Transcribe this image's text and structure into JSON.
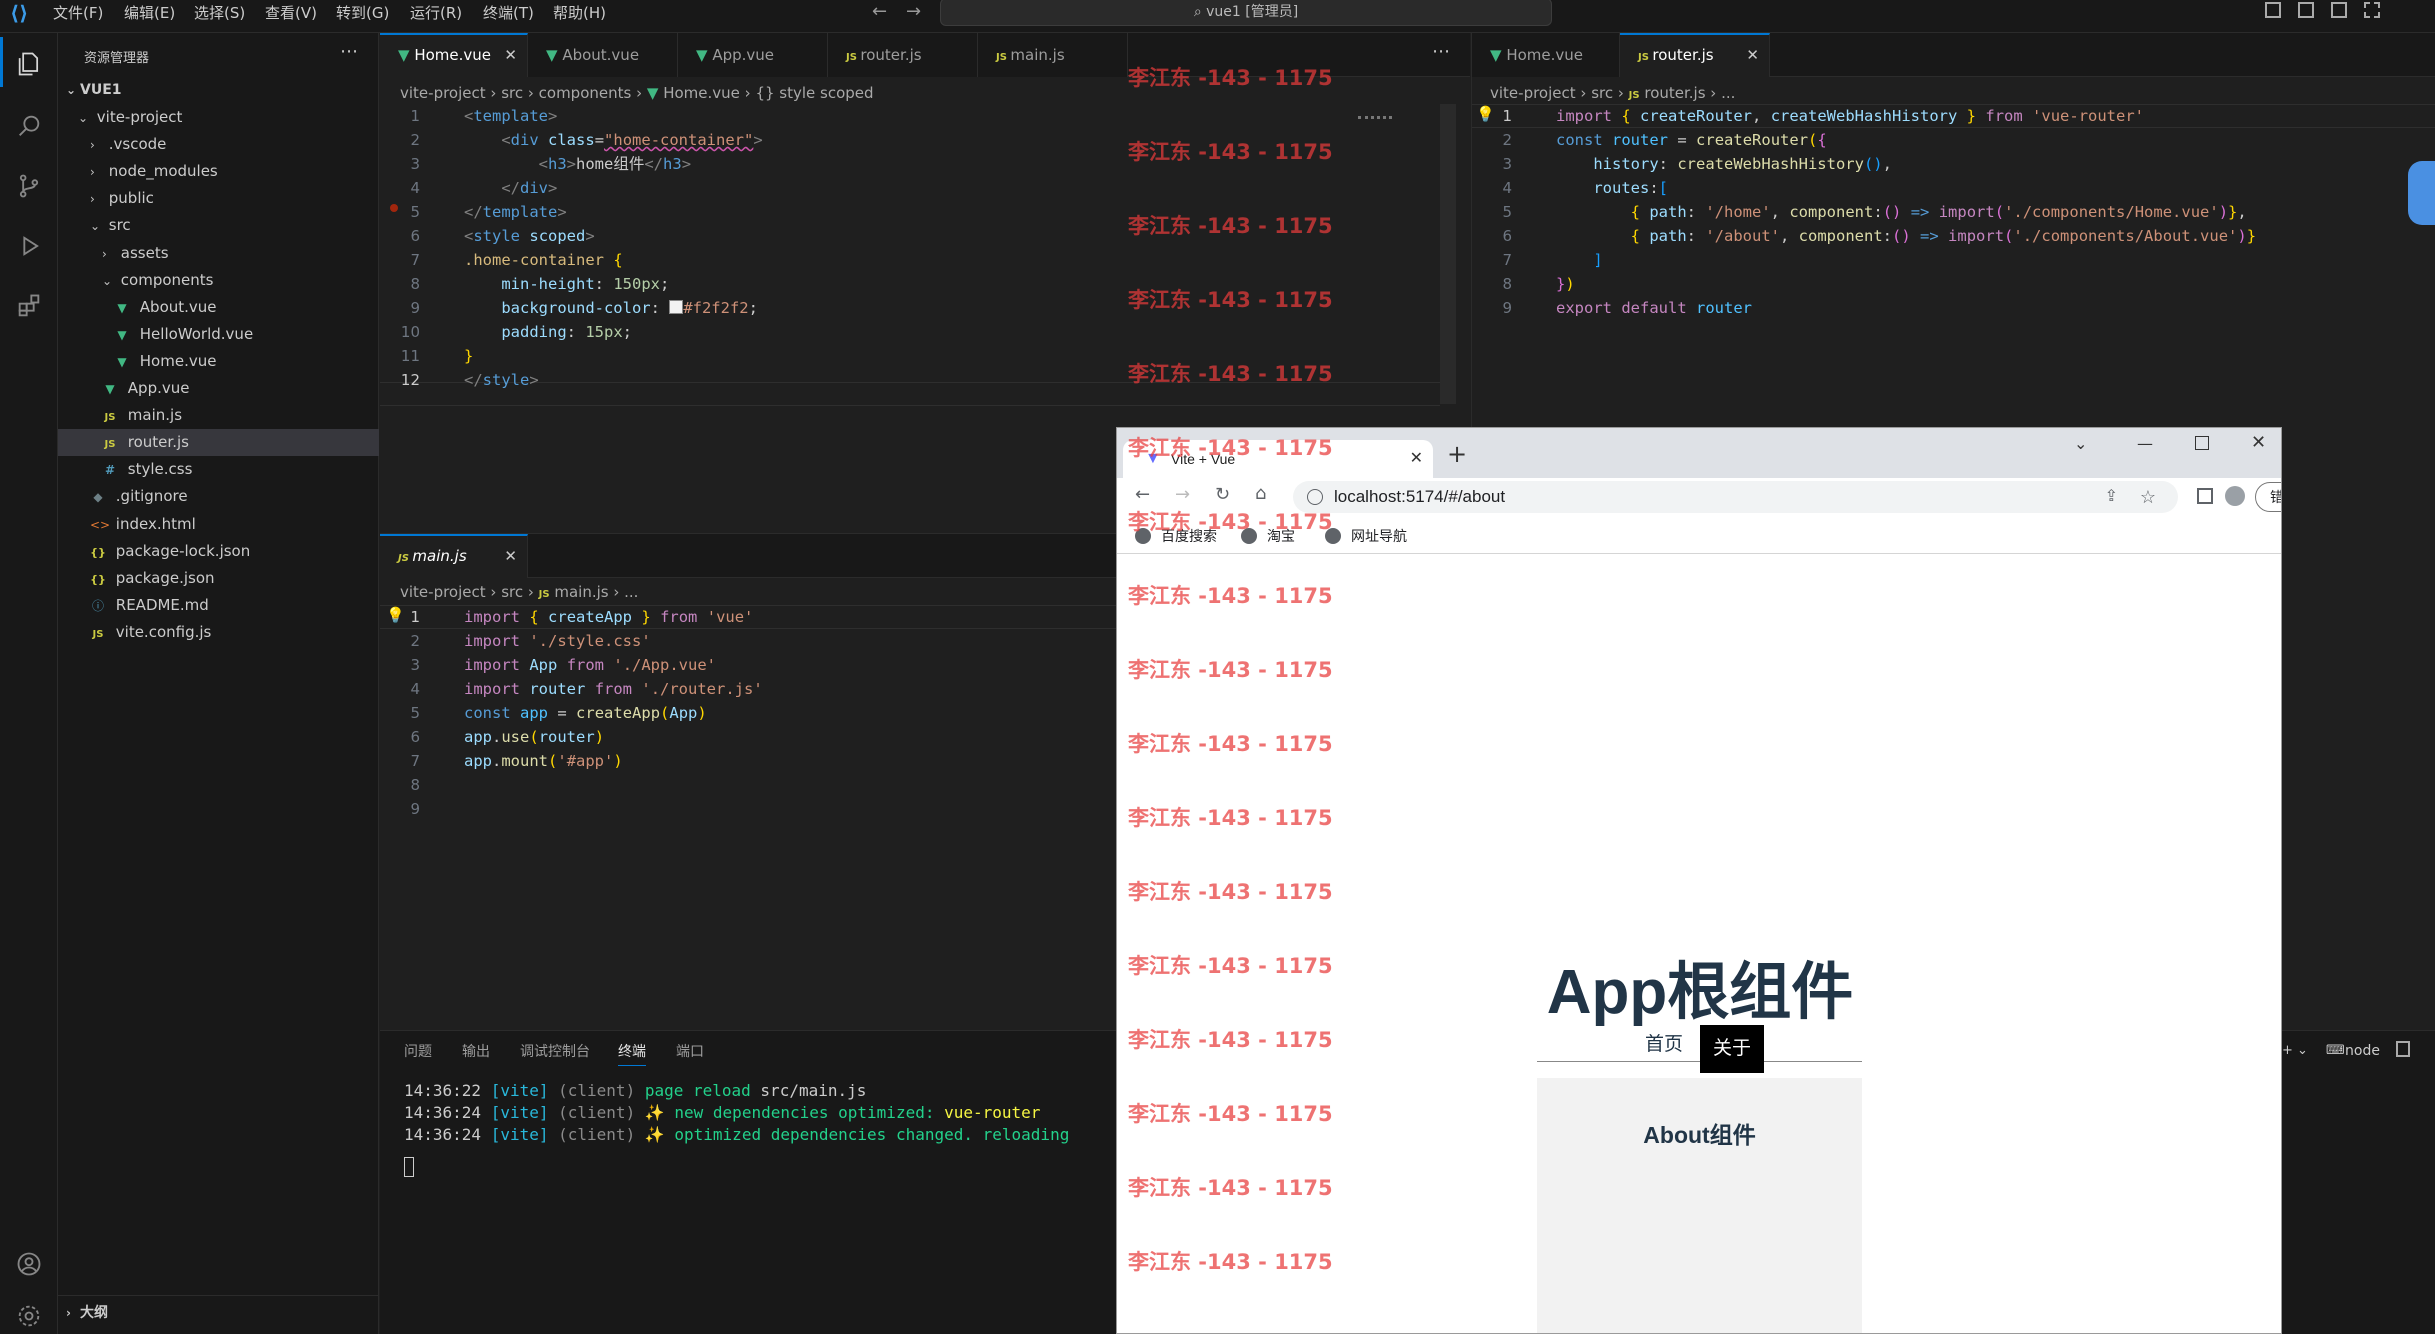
{
  "menu": [
    "文件(F)",
    "编辑(E)",
    "选择(S)",
    "查看(V)",
    "转到(G)",
    "运行(R)",
    "终端(T)",
    "帮助(H)"
  ],
  "window_title": "vue1 [管理员]",
  "explorer": {
    "title": "资源管理器",
    "root": "VUE1",
    "items": [
      {
        "label": "vite-project",
        "type": "folder-open"
      },
      {
        "label": ".vscode",
        "type": "folder"
      },
      {
        "label": "node_modules",
        "type": "folder"
      },
      {
        "label": "public",
        "type": "folder"
      },
      {
        "label": "src",
        "type": "folder-open"
      },
      {
        "label": "assets",
        "type": "folder"
      },
      {
        "label": "components",
        "type": "folder-open"
      },
      {
        "label": "About.vue",
        "type": "vue"
      },
      {
        "label": "HelloWorld.vue",
        "type": "vue"
      },
      {
        "label": "Home.vue",
        "type": "vue"
      },
      {
        "label": "App.vue",
        "type": "vue"
      },
      {
        "label": "main.js",
        "type": "js"
      },
      {
        "label": "router.js",
        "type": "js"
      },
      {
        "label": "style.css",
        "type": "css"
      },
      {
        "label": ".gitignore",
        "type": "git"
      },
      {
        "label": "index.html",
        "type": "html"
      },
      {
        "label": "package-lock.json",
        "type": "json"
      },
      {
        "label": "package.json",
        "type": "json"
      },
      {
        "label": "README.md",
        "type": "info"
      },
      {
        "label": "vite.config.js",
        "type": "js"
      }
    ],
    "outline": "大纲"
  },
  "editor1": {
    "tabs": [
      "Home.vue",
      "About.vue",
      "App.vue",
      "router.js",
      "main.js"
    ],
    "breadcrumb": [
      "vite-project",
      "src",
      "components",
      "Home.vue",
      "{} style scoped"
    ],
    "line_numbers": [
      "1",
      "2",
      "3",
      "4",
      "5",
      "6",
      "7",
      "8",
      "9",
      "10",
      "11",
      "12"
    ]
  },
  "editor2": {
    "tab": "main.js",
    "breadcrumb": [
      "vite-project",
      "src",
      "main.js",
      "..."
    ],
    "line_numbers": [
      "1",
      "2",
      "3",
      "4",
      "5",
      "6",
      "7",
      "8",
      "9"
    ]
  },
  "editor3": {
    "tabs": [
      "Home.vue",
      "router.js"
    ],
    "breadcrumb": [
      "vite-project",
      "src",
      "router.js",
      "..."
    ],
    "line_numbers": [
      "1",
      "2",
      "3",
      "4",
      "5",
      "6",
      "7",
      "8",
      "9"
    ]
  },
  "panel": {
    "tabs": [
      "问题",
      "输出",
      "调试控制台",
      "终端",
      "端口"
    ],
    "lines": [
      {
        "time": "14:36:22",
        "tag": "[vite]",
        "src": "(client)",
        "msg": "page reload ",
        "path": "src/main.js"
      },
      {
        "time": "14:36:24",
        "tag": "[vite]",
        "src": "(client)",
        "msg": "✨ new dependencies optimized: ",
        "path": "vue-router"
      },
      {
        "time": "14:36:24",
        "tag": "[vite]",
        "src": "(client)",
        "msg": "✨ optimized dependencies changed. reloading",
        "path": ""
      }
    ],
    "node_label": "node"
  },
  "browser": {
    "tab_title": "Vite + Vue",
    "url": "localhost:5174/#/about",
    "profile_button": "错误",
    "bookmarks": [
      "百度搜索",
      "淘宝",
      "网址导航"
    ],
    "page": {
      "heading": "App根组件",
      "nav": [
        "首页",
        "关于"
      ],
      "content_title": "About组件"
    }
  },
  "watermark": "李江东 -143 - 1175",
  "colors": {
    "accent": "#0078d4",
    "vue_green": "#41b883",
    "watermark": "#e83c3c",
    "active_nav": "#000000",
    "content_bg": "#f2f2f2"
  }
}
